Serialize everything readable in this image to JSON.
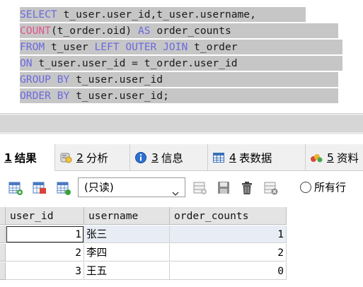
{
  "sql": {
    "lines": [
      [
        {
          "t": "SELECT",
          "c": "kw"
        },
        {
          "t": " t_user.user_id,t_user.username,",
          "c": ""
        }
      ],
      [
        {
          "t": "COUNT",
          "c": "fn"
        },
        {
          "t": "(t_order.oid) ",
          "c": ""
        },
        {
          "t": "AS",
          "c": "kw"
        },
        {
          "t": " order_counts",
          "c": ""
        }
      ],
      [
        {
          "t": "FROM",
          "c": "kw"
        },
        {
          "t": " t_user ",
          "c": ""
        },
        {
          "t": "LEFT OUTER JOIN",
          "c": "kw"
        },
        {
          "t": " t_order",
          "c": ""
        }
      ],
      [
        {
          "t": "ON",
          "c": "kw"
        },
        {
          "t": " t_user.user_id = t_order.user_id",
          "c": ""
        }
      ],
      [
        {
          "t": "GROUP BY",
          "c": "kw"
        },
        {
          "t": " t_user.user_id",
          "c": ""
        }
      ],
      [
        {
          "t": "ORDER BY",
          "c": "kw"
        },
        {
          "t": " t_user.user_id;",
          "c": ""
        }
      ]
    ],
    "colors": {
      "keyword": "#6a6adf",
      "function": "#e0548c",
      "selection": "#c6c6c6"
    }
  },
  "tabs": [
    {
      "num": "1",
      "label": "结果",
      "icon": "results-icon",
      "active": true
    },
    {
      "num": "2",
      "label": "分析",
      "icon": "profiler-icon",
      "active": false
    },
    {
      "num": "3",
      "label": "信息",
      "icon": "info-icon",
      "active": false
    },
    {
      "num": "4",
      "label": "表数据",
      "icon": "table-data-icon",
      "active": false
    },
    {
      "num": "5",
      "label": "资料",
      "icon": "history-icon",
      "active": false
    }
  ],
  "toolbar": {
    "mode": "(只读)",
    "all_rows_label": "所有行"
  },
  "grid": {
    "columns": [
      "user_id",
      "username",
      "order_counts"
    ],
    "rows": [
      {
        "user_id": "1",
        "username": "张三",
        "order_counts": "1"
      },
      {
        "user_id": "2",
        "username": "李四",
        "order_counts": "2"
      },
      {
        "user_id": "3",
        "username": "王五",
        "order_counts": "0"
      }
    ]
  }
}
